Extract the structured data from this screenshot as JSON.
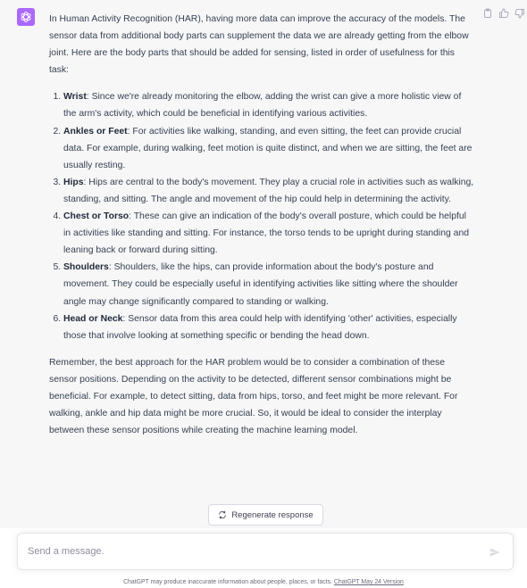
{
  "colors": {
    "avatar_bg": "#ab68ff",
    "message_bg": "#f7f7f8",
    "text": "#374151"
  },
  "icons": {
    "assistant_avatar": "openai-logo-icon",
    "copy": "clipboard-icon",
    "like": "thumbs-up-icon",
    "dislike": "thumbs-down-icon",
    "regenerate": "refresh-icon",
    "send": "paper-plane-icon"
  },
  "message": {
    "intro": "In Human Activity Recognition (HAR), having more data can improve the accuracy of the models. The sensor data from additional body parts can supplement the data we are already getting from the elbow joint. Here are the body parts that should be added for sensing, listed in order of usefulness for this task:",
    "items": [
      {
        "title": "Wrist",
        "text": ": Since we're already monitoring the elbow, adding the wrist can give a more holistic view of the arm's activity, which could be beneficial in identifying various activities."
      },
      {
        "title": "Ankles or Feet",
        "text": ": For activities like walking, standing, and even sitting, the feet can provide crucial data. For example, during walking, feet motion is quite distinct, and when we are sitting, the feet are usually resting."
      },
      {
        "title": "Hips",
        "text": ": Hips are central to the body's movement. They play a crucial role in activities such as walking, standing, and sitting. The angle and movement of the hip could help in determining the activity."
      },
      {
        "title": "Chest or Torso",
        "text": ": These can give an indication of the body's overall posture, which could be helpful in activities like standing and sitting. For instance, the torso tends to be upright during standing and leaning back or forward during sitting."
      },
      {
        "title": "Shoulders",
        "text": ": Shoulders, like the hips, can provide information about the body's posture and movement. They could be especially useful in identifying activities like sitting where the shoulder angle may change significantly compared to standing or walking."
      },
      {
        "title": "Head or Neck",
        "text": ": Sensor data from this area could help with identifying 'other' activities, especially those that involve looking at something specific or bending the head down."
      }
    ],
    "conclusion": "Remember, the best approach for the HAR problem would be to consider a combination of these sensor positions. Depending on the activity to be detected, different sensor combinations might be beneficial. For example, to detect sitting, data from hips, torso, and feet might be more relevant. For walking, ankle and hip data might be more crucial. So, it would be ideal to consider the interplay between these sensor positions while creating the machine learning model."
  },
  "regenerate_label": "Regenerate response",
  "composer": {
    "placeholder": "Send a message.",
    "value": ""
  },
  "footer": {
    "disclaimer": "ChatGPT may produce inaccurate information about people, places, or facts. ",
    "version_link": "ChatGPT May 24 Version"
  }
}
